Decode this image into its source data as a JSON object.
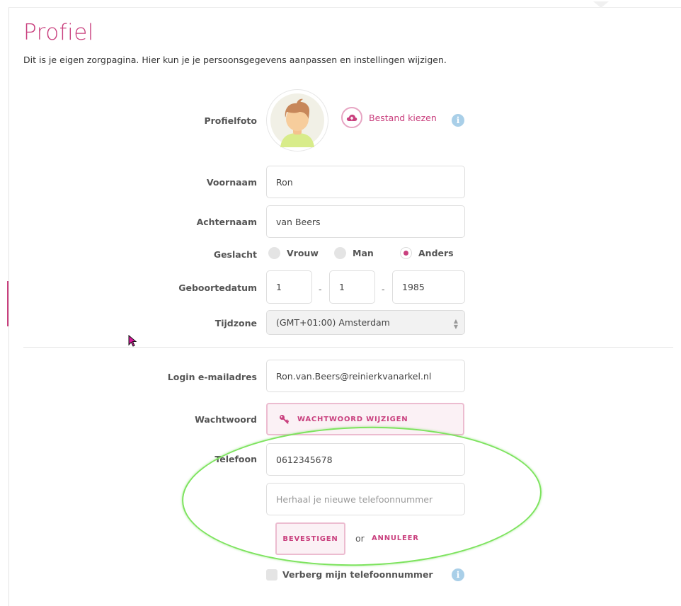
{
  "page": {
    "title": "Profiel",
    "subtitle": "Dit is je eigen zorgpagina. Hier kun je je persoonsgegevens aanpassen en instellingen wijzigen."
  },
  "colors": {
    "accent": "#c9407e",
    "accent_light": "#fbf1f5",
    "info": "#a9cfe8",
    "highlight_ellipse": "#7de35e"
  },
  "profile_photo": {
    "label": "Profielfoto",
    "upload_label": "Bestand kiezen",
    "upload_icon": "cloud-upload-icon",
    "info_icon": "info-icon"
  },
  "first_name": {
    "label": "Voornaam",
    "value": "Ron"
  },
  "last_name": {
    "label": "Achternaam",
    "value": "van Beers"
  },
  "gender": {
    "label": "Geslacht",
    "options": [
      {
        "label": "Vrouw",
        "selected": false
      },
      {
        "label": "Man",
        "selected": false
      },
      {
        "label": "Anders",
        "selected": true
      }
    ]
  },
  "birthdate": {
    "label": "Geboortedatum",
    "day": "1",
    "month": "1",
    "year": "1985",
    "separator": "-"
  },
  "timezone": {
    "label": "Tijdzone",
    "value": "(GMT+01:00) Amsterdam"
  },
  "login_email": {
    "label": "Login e-mailadres",
    "value": "Ron.van.Beers@reinierkvanarkel.nl"
  },
  "password": {
    "label": "Wachtwoord",
    "button_label": "WACHTWOORD WIJZIGEN",
    "icon": "key-icon"
  },
  "phone": {
    "label": "Telefoon",
    "value": "0612345678",
    "repeat_placeholder": "Herhaal je nieuwe telefoonnummer",
    "confirm_label": "BEVESTIGEN",
    "or_label": "or",
    "cancel_label": "ANNULEER",
    "hide_label": "Verberg mijn telefoonnummer",
    "hide_checked": false
  }
}
